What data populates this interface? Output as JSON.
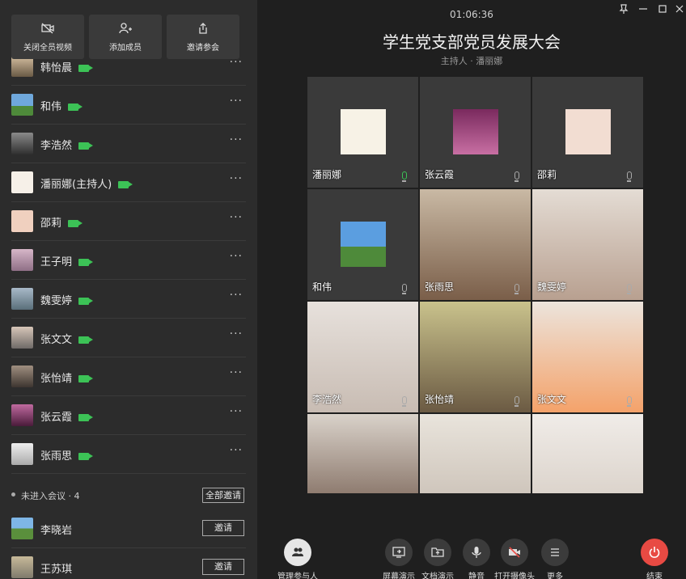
{
  "toolbar": {
    "buttons": [
      {
        "label": "关闭全员视频",
        "icon": "camera-off-icon"
      },
      {
        "label": "添加成员",
        "icon": "add-user-icon"
      },
      {
        "label": "邀请参会",
        "icon": "share-icon"
      }
    ]
  },
  "participants": [
    {
      "name": "韩怡晨"
    },
    {
      "name": "和伟"
    },
    {
      "name": "李浩然"
    },
    {
      "name": "潘丽娜(主持人)"
    },
    {
      "name": "邵莉"
    },
    {
      "name": "王子明"
    },
    {
      "name": "魏雯婷"
    },
    {
      "name": "张文文"
    },
    {
      "name": "张怡靖"
    },
    {
      "name": "张云霞"
    },
    {
      "name": "张雨思"
    }
  ],
  "more_label": "···",
  "pending": {
    "label": "未进入会议 · 4",
    "invite_all_label": "全部邀请",
    "invite_label": "邀请",
    "people": [
      {
        "name": "李晓岩"
      },
      {
        "name": "王苏琪"
      }
    ]
  },
  "meeting": {
    "time": "01:06:36",
    "title": "学生党支部党员发展大会",
    "host": "主持人 · 潘丽娜"
  },
  "tiles": [
    {
      "name": "潘丽娜",
      "mic": "on"
    },
    {
      "name": "张云霞",
      "mic": "off"
    },
    {
      "name": "邵莉",
      "mic": "off"
    },
    {
      "name": "和伟",
      "mic": "off"
    },
    {
      "name": "张雨思",
      "mic": "off"
    },
    {
      "name": "魏雯婷",
      "mic": "off"
    },
    {
      "name": "李浩然",
      "mic": "off"
    },
    {
      "name": "张怡靖",
      "mic": "off"
    },
    {
      "name": "张文文",
      "mic": "off"
    },
    {
      "name": "",
      "mic": "off"
    },
    {
      "name": "",
      "mic": "off"
    },
    {
      "name": "",
      "mic": "off"
    }
  ],
  "bottom": {
    "manage": "管理参与人",
    "screen": "屏幕演示",
    "doc": "文档演示",
    "mute": "静音",
    "camera": "打开摄像头",
    "more": "更多",
    "end": "结束"
  },
  "colors": {
    "accent_green": "#3cc256",
    "end_red": "#e84a43"
  }
}
